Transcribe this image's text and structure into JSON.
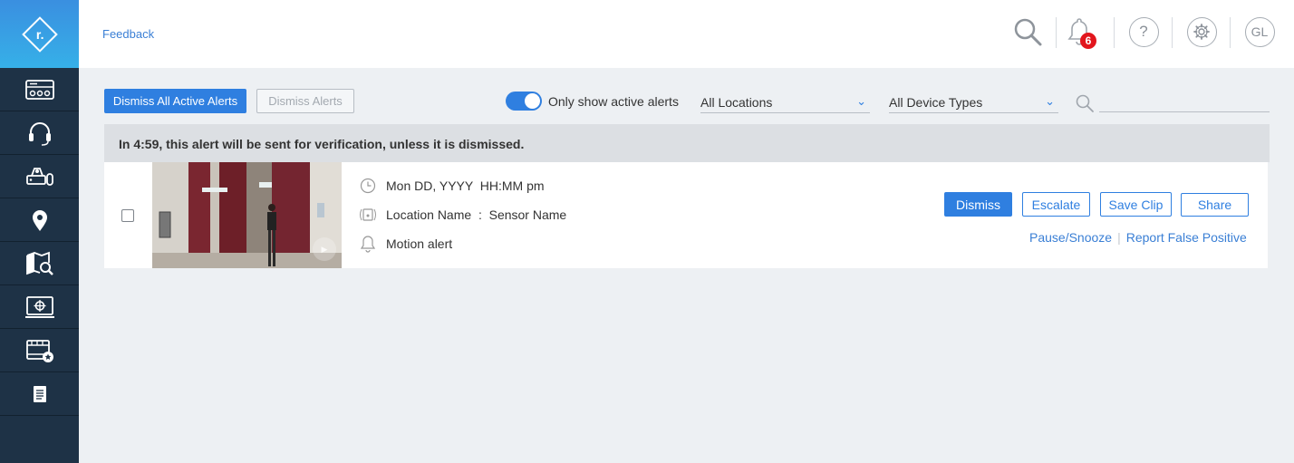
{
  "app": {
    "logo_letter": "r."
  },
  "header": {
    "feedback_label": "Feedback",
    "notification_count": "6",
    "help_label": "?",
    "user_initials": "GL"
  },
  "sidebar": {
    "items": [
      {
        "icon": "dashboard-icon"
      },
      {
        "icon": "headset-icon"
      },
      {
        "icon": "devices-icon"
      },
      {
        "icon": "location-pin-icon"
      },
      {
        "icon": "map-search-icon"
      },
      {
        "icon": "monitor-icon"
      },
      {
        "icon": "video-clip-icon"
      },
      {
        "icon": "report-icon"
      }
    ]
  },
  "toolbar": {
    "dismiss_all_label": "Dismiss All Active Alerts",
    "dismiss_alerts_label": "Dismiss Alerts",
    "toggle_label": "Only show active alerts",
    "toggle_on": true,
    "locations_selected": "All Locations",
    "device_types_selected": "All Device Types",
    "search_value": ""
  },
  "banner": {
    "text": "In 4:59, this alert will be sent for verification, unless it is dismissed."
  },
  "alert": {
    "timestamp": "Mon DD, YYYY  HH:MM pm",
    "location": "Location Name  :  Sensor Name",
    "type": "Motion alert",
    "dismiss_label": "Dismiss",
    "escalate_label": "Escalate",
    "save_clip_label": "Save Clip",
    "share_label": "Share",
    "pause_label": "Pause/Snooze",
    "report_label": "Report False Positive"
  },
  "colors": {
    "accent": "#2f7fe0",
    "sidebar": "#1e3246",
    "badge": "#e2161d"
  }
}
